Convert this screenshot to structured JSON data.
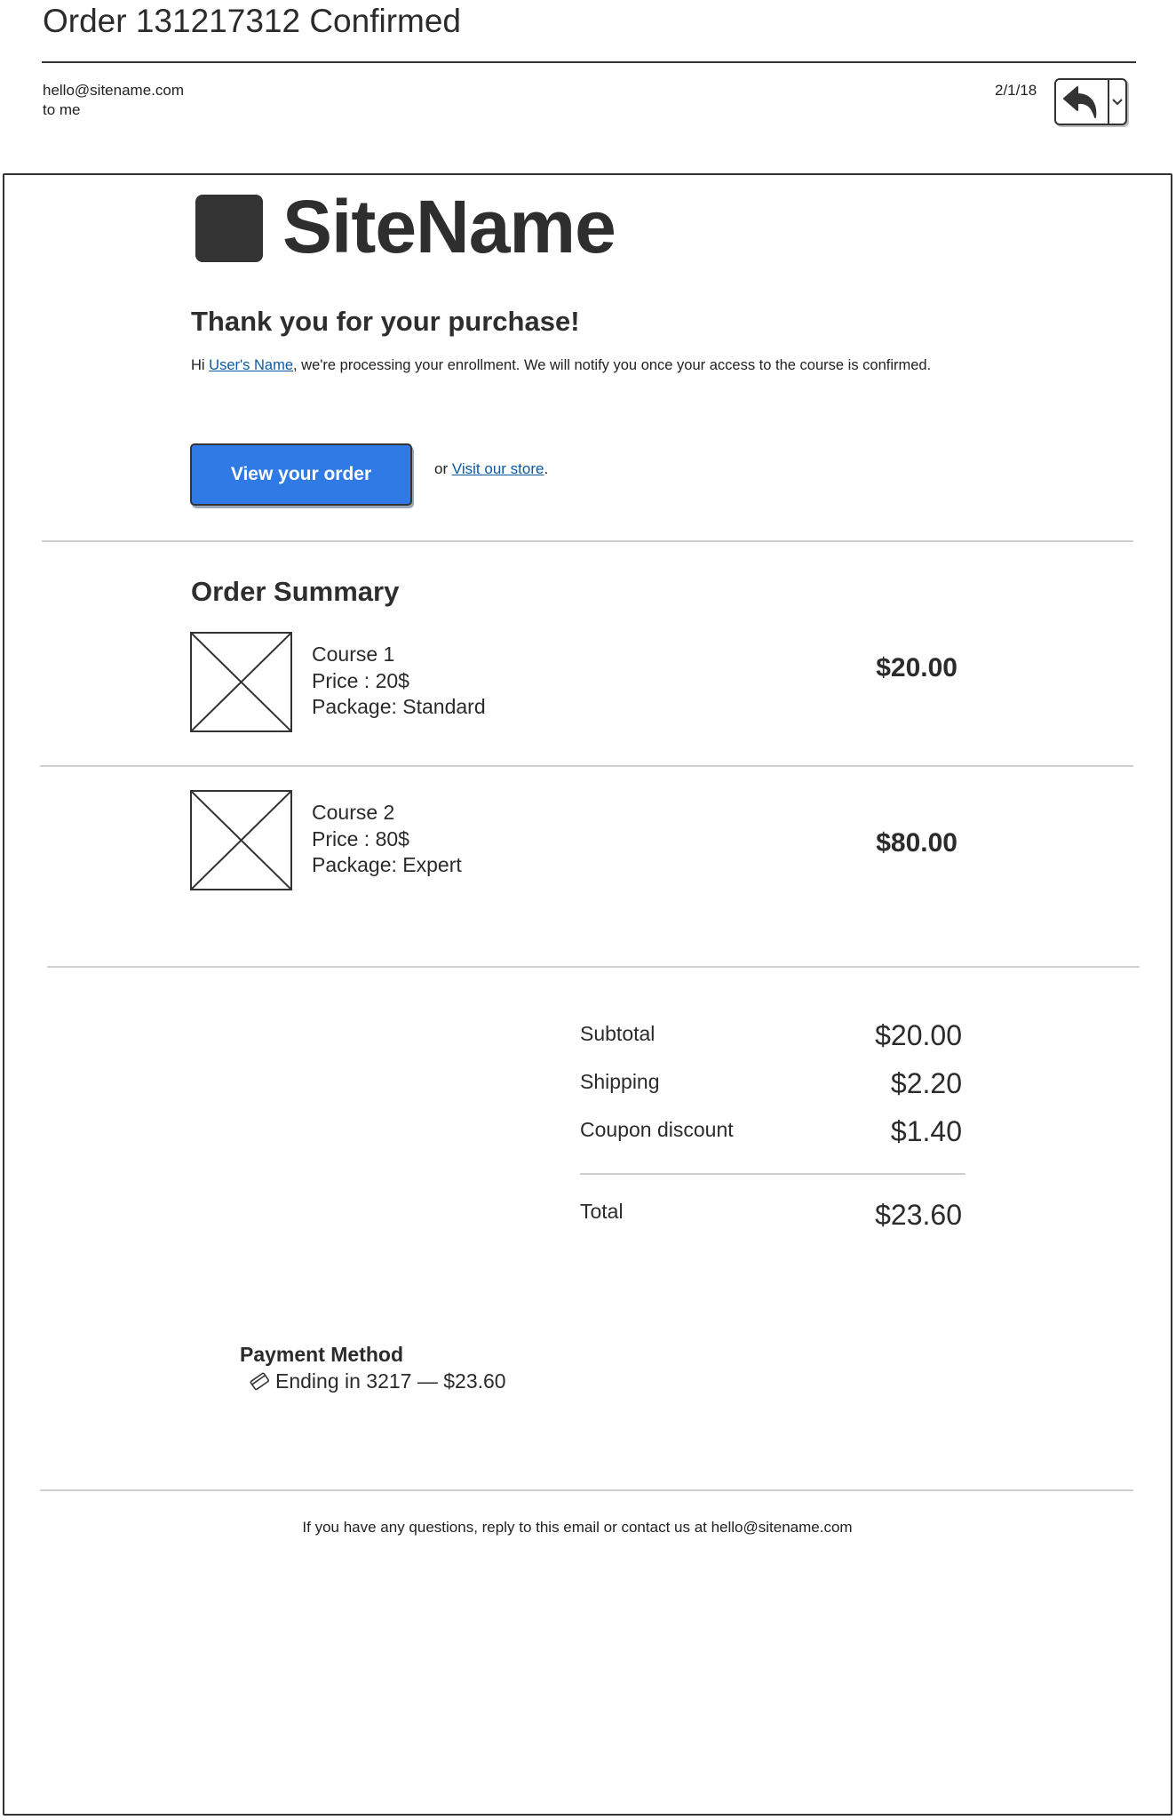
{
  "email": {
    "subject": "Order 131217312 Confirmed",
    "sender": "hello@sitename.com",
    "recipient": "to me",
    "date": "2/1/18"
  },
  "icons": {
    "reply": "reply-arrow-icon",
    "menu": "chevron-down-icon",
    "logo": "logo-square-icon",
    "thumbnail": "image-placeholder-icon",
    "card": "credit-card-icon"
  },
  "colors": {
    "primary_button": "#2f7ae5",
    "link": "#0b5aa6",
    "logo": "#333333"
  },
  "brand": {
    "name": "SiteName"
  },
  "greeting": {
    "heading": "Thank you for your purchase!",
    "prefix": "Hi ",
    "user_name": "User's Name",
    "message": ", we're processing your enrollment. We will notify you once your access to the course is confirmed."
  },
  "actions": {
    "view_order": "View your order",
    "or_text": "or ",
    "store_link": "Visit our store",
    "store_suffix": "."
  },
  "order_summary": {
    "title": "Order Summary",
    "items": [
      {
        "name": "Course 1",
        "price_line": "Price : 20$",
        "package": "Package: Standard",
        "amount": "$20.00"
      },
      {
        "name": "Course 2",
        "price_line": "Price : 80$",
        "package": "Package: Expert",
        "amount": "$80.00"
      }
    ]
  },
  "totals": {
    "subtotal_label": "Subtotal",
    "subtotal": "$20.00",
    "shipping_label": "Shipping",
    "shipping": "$2.20",
    "coupon_label": "Coupon discount",
    "coupon": "$1.40",
    "total_label": "Total",
    "total": "$23.60"
  },
  "payment": {
    "title": "Payment Method",
    "detail": "Ending in 3217 — $23.60"
  },
  "footer": {
    "note": "If you have any questions, reply to this email or contact us at hello@sitename.com"
  }
}
